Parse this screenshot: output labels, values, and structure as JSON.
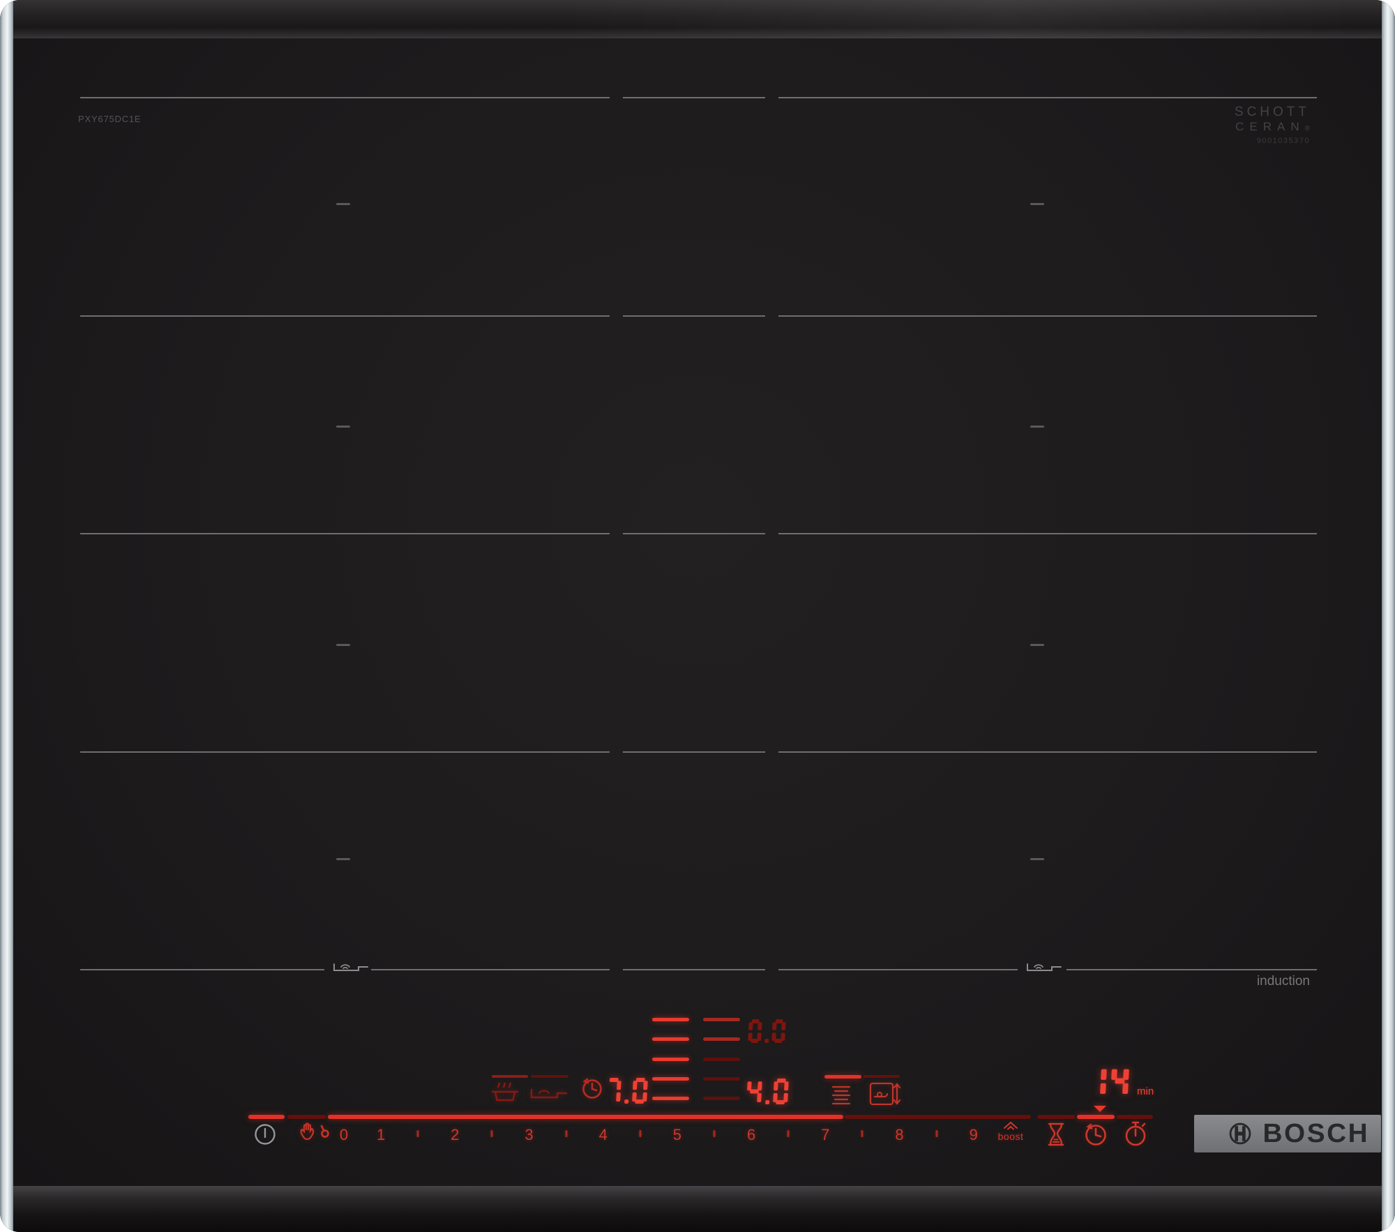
{
  "labels": {
    "model": "PXY675DC1E",
    "schott_line1": "SCHOTT",
    "schott_line2": "CERAN",
    "schott_reg": "®",
    "schott_code": "9001035370",
    "induction": "induction",
    "brand": "BOSCH",
    "boost": "boost",
    "timer_unit": "min"
  },
  "displays": {
    "left_zone_power": "7.0",
    "right_zone_power": "4.0",
    "rear_zone_power": "0.0",
    "timer_minutes": "14"
  },
  "slider": {
    "keys": [
      "0",
      "1",
      "2",
      "3",
      "4",
      "5",
      "6",
      "7",
      "8",
      "9"
    ],
    "active_level": "7",
    "boost_label": "boost"
  },
  "indicators": {
    "left_flex_ladder": [
      "on",
      "on",
      "on",
      "on",
      "on"
    ],
    "right_flex_ladder": [
      "mid",
      "mid",
      "dim",
      "dim",
      "dim"
    ],
    "left_mini_bar": [
      "mid",
      "dim"
    ],
    "right_mini_bar": [
      "on",
      "dim"
    ],
    "timer_bar": [
      "dim",
      "on",
      "dim"
    ],
    "power_bar": [
      "on",
      "dim"
    ]
  },
  "icons": {
    "power": "power-icon",
    "wipe_lock": "hand-lock-icon",
    "keep_warm": "pot-steam-icon",
    "pan_sensor": "pan-wave-icon",
    "zone_timer": "clock-arrow-icon",
    "flex_levels": "flex-lines-icon",
    "pan_transfer": "pan-move-icon",
    "shortterm_timer": "hourglass-icon",
    "cooking_timer": "timer-clock-icon",
    "alarm": "stopwatch-icon",
    "pan_detect_left": "pan-detect-icon",
    "pan_detect_right": "pan-detect-icon",
    "bosch_emblem": "bosch-armature-icon"
  },
  "colors": {
    "red_on": "#e93b2e",
    "red_mid": "#a8281f",
    "red_dim": "#5f100c",
    "zone_line": "#6f6f6f",
    "glass": "#1c1a1b",
    "trim": "#c7d1d6",
    "plate": "#7b7c7f"
  }
}
